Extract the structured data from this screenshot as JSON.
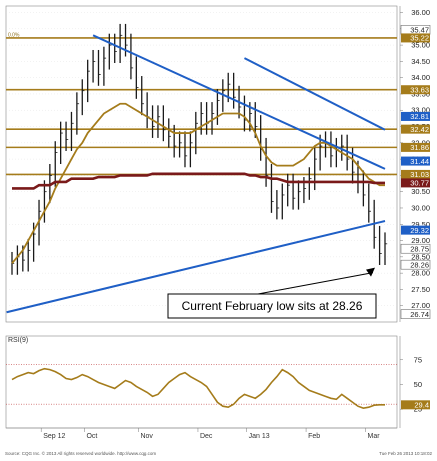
{
  "chart_data": [
    {
      "type": "line",
      "panel": "price",
      "title": "",
      "xlabel": "",
      "ylabel": "",
      "x_tick_labels": [
        "Sep 12",
        "Oct",
        "Nov",
        "Dec",
        "Jan 13",
        "Feb",
        "Mar"
      ],
      "ylim": [
        26.5,
        36.2
      ],
      "y_ticks": [
        27.0,
        27.5,
        28.0,
        28.5,
        29.0,
        29.5,
        30.0,
        30.5,
        31.0,
        31.5,
        32.0,
        32.5,
        33.0,
        33.5,
        34.0,
        34.5,
        35.0,
        35.5,
        36.0
      ],
      "y_tick_labels": [
        "27.00",
        "27.50",
        "28.00",
        "28.50",
        "29.00",
        "29.50",
        "30.00",
        "30.50",
        "31.00",
        "31.50",
        "32.00",
        "32.50",
        "33.00",
        "33.50",
        "34.00",
        "34.50",
        "35.00",
        "35.50",
        "36.00"
      ],
      "price_badges": [
        {
          "label": "35.47",
          "value": 35.47,
          "color": "#ffffff"
        },
        {
          "label": "35.22",
          "value": 35.22,
          "color": "#a57c1b"
        },
        {
          "label": "33.63",
          "value": 33.63,
          "color": "#a57c1b"
        },
        {
          "label": "32.81",
          "value": 32.81,
          "color": "#1f5fc6"
        },
        {
          "label": "32.42",
          "value": 32.42,
          "color": "#a57c1b"
        },
        {
          "label": "31.86",
          "value": 31.86,
          "color": "#a57c1b"
        },
        {
          "label": "31.44",
          "value": 31.44,
          "color": "#1f5fc6"
        },
        {
          "label": "31.03",
          "value": 31.03,
          "color": "#a57c1b"
        },
        {
          "label": "30.77",
          "value": 30.77,
          "color": "#7a1a1a"
        },
        {
          "label": "29.32",
          "value": 29.32,
          "color": "#1f5fc6"
        },
        {
          "label": "28.75",
          "value": 28.75,
          "color": "#ffffff"
        },
        {
          "label": "28.26",
          "value": 28.26,
          "color": "#ffffff"
        },
        {
          "label": "26.74",
          "value": 26.74,
          "color": "#ffffff"
        }
      ],
      "fib_levels": [
        35.22,
        33.63,
        32.42,
        31.86,
        31.03
      ],
      "fib_labels": [
        "0.0%",
        "",
        "",
        "",
        ""
      ],
      "trendlines": [
        {
          "name": "",
          "color": "#1f5fc6",
          "points": [
            [
              15,
              35.3
            ],
            [
              69,
              31.2
            ]
          ]
        },
        {
          "name": "",
          "color": "#1f5fc6",
          "points": [
            [
              43,
              34.6
            ],
            [
              69,
              32.4
            ]
          ]
        },
        {
          "name": "",
          "color": "#1f5fc6",
          "points": [
            [
              -1,
              26.8
            ],
            [
              69,
              29.6
            ]
          ]
        }
      ],
      "series": [
        {
          "name": "",
          "kind": "price",
          "color": "#1a1a1a",
          "values": [
            28.3,
            28.5,
            28.4,
            28.7,
            29.2,
            29.9,
            30.5,
            31.0,
            31.7,
            32.3,
            32.1,
            32.6,
            33.2,
            33.6,
            34.2,
            34.5,
            34.1,
            34.6,
            35.0,
            34.8,
            35.3,
            35.0,
            34.3,
            33.7,
            33.2,
            32.8,
            32.5,
            32.8,
            32.4,
            32.2,
            31.9,
            32.0,
            31.6,
            32.0,
            32.6,
            32.9,
            32.6,
            32.9,
            33.3,
            33.6,
            33.8,
            33.4,
            33.1,
            32.7,
            32.9,
            32.5,
            31.8,
            31.0,
            30.2,
            30.0,
            30.4,
            30.7,
            30.3,
            30.5,
            30.6,
            30.9,
            31.5,
            31.9,
            32.0,
            31.6,
            31.8,
            31.9,
            31.5,
            31.1,
            30.8,
            30.4,
            29.9,
            29.1,
            28.6,
            28.9
          ]
        },
        {
          "name": "",
          "kind": "moving-average",
          "color": "#a57c1b",
          "values": [
            28.3,
            28.5,
            28.7,
            29.0,
            29.3,
            29.6,
            29.9,
            30.2,
            30.6,
            30.9,
            31.2,
            31.5,
            31.8,
            32.0,
            32.3,
            32.5,
            32.7,
            32.9,
            33.0,
            33.1,
            33.2,
            33.2,
            33.1,
            33.0,
            32.9,
            32.8,
            32.7,
            32.6,
            32.5,
            32.4,
            32.3,
            32.3,
            32.3,
            32.3,
            32.4,
            32.5,
            32.6,
            32.7,
            32.8,
            32.9,
            32.9,
            32.9,
            32.9,
            32.8,
            32.6,
            32.3,
            31.9,
            31.6,
            31.4,
            31.3,
            31.3,
            31.3,
            31.3,
            31.4,
            31.5,
            31.7,
            31.9,
            32.0,
            32.0,
            31.9,
            31.8,
            31.7,
            31.6,
            31.5,
            31.3,
            31.1,
            30.9,
            30.8,
            30.7,
            30.7
          ]
        },
        {
          "name": "",
          "kind": "moving-average",
          "color": "#7a1a1a",
          "values": [
            30.6,
            30.6,
            30.6,
            30.6,
            30.6,
            30.7,
            30.7,
            30.7,
            30.8,
            30.8,
            30.8,
            30.9,
            30.9,
            30.9,
            30.9,
            30.9,
            30.95,
            30.95,
            30.95,
            30.95,
            31.0,
            31.0,
            31.0,
            31.0,
            31.0,
            31.0,
            31.05,
            31.05,
            31.05,
            31.05,
            31.05,
            31.05,
            31.05,
            31.05,
            31.05,
            31.05,
            31.05,
            31.05,
            31.05,
            31.05,
            31.05,
            31.05,
            31.05,
            31.05,
            31.0,
            31.0,
            30.95,
            30.95,
            30.9,
            30.9,
            30.85,
            30.8,
            30.8,
            30.8,
            30.8,
            30.8,
            30.8,
            30.8,
            30.8,
            30.8,
            30.8,
            30.8,
            30.8,
            30.8,
            30.8,
            30.8,
            30.8,
            30.77,
            30.77,
            30.77
          ]
        }
      ],
      "annotations": [
        {
          "text": "Current February low sits at 28.26",
          "points_to_value": 28.26
        }
      ]
    },
    {
      "type": "line",
      "panel": "indicator",
      "title": "RSI(9)",
      "ylim": [
        10,
        95
      ],
      "y_ticks": [
        25,
        50,
        75
      ],
      "y_tick_labels": [
        "25",
        "50",
        "75"
      ],
      "reference_lines": [
        30,
        70
      ],
      "value_badge": {
        "label": "29.4",
        "value": 29.4,
        "color": "#a57c1b"
      },
      "series": [
        {
          "name": "",
          "color": "#a57c1b",
          "values": [
            55,
            58,
            60,
            62,
            61,
            64,
            66,
            65,
            63,
            60,
            56,
            55,
            57,
            60,
            58,
            55,
            52,
            50,
            48,
            46,
            50,
            54,
            52,
            48,
            45,
            42,
            38,
            40,
            46,
            52,
            56,
            60,
            62,
            58,
            55,
            52,
            48,
            40,
            32,
            28,
            27,
            30,
            36,
            40,
            38,
            36,
            40,
            45,
            52,
            58,
            65,
            62,
            58,
            52,
            48,
            44,
            42,
            40,
            38,
            36,
            35,
            40,
            36,
            32,
            28,
            26,
            27,
            29,
            29.4,
            29.4
          ]
        }
      ]
    }
  ],
  "footer": {
    "left": "Source: CQG Inc. © 2013 All rights reserved worldwide. http://www.cqg.com",
    "right": "Tue Feb 26 2013 10:18:02"
  }
}
